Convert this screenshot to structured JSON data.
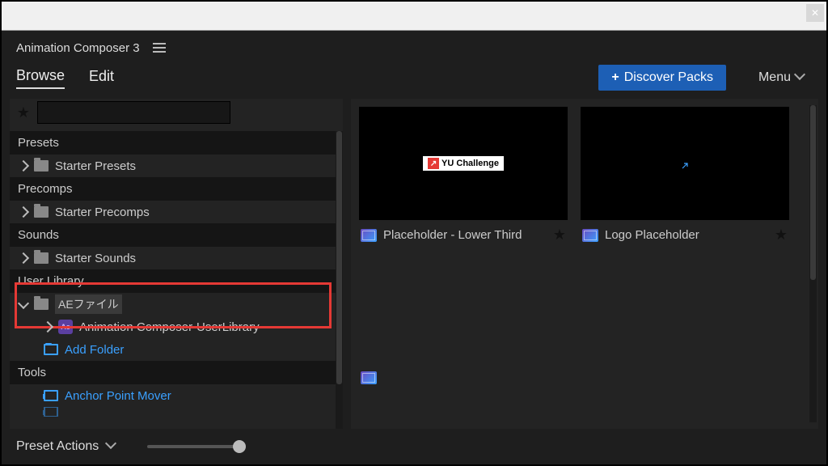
{
  "panel": {
    "title": "Animation Composer 3"
  },
  "tabs": {
    "browse": "Browse",
    "edit": "Edit"
  },
  "buttons": {
    "discover": "Discover Packs",
    "menu": "Menu"
  },
  "search": {
    "placeholder": ""
  },
  "tree": {
    "presets_header": "Presets",
    "starter_presets": "Starter Presets",
    "precomps_header": "Precomps",
    "starter_precomps": "Starter Precomps",
    "sounds_header": "Sounds",
    "starter_sounds": "Starter Sounds",
    "user_library_header": "User Library",
    "ae_folder": "AEファイル",
    "ac_userlib": "Animation Composer-UserLibrary",
    "add_folder": "Add Folder",
    "tools_header": "Tools",
    "anchor_point": "Anchor Point Mover"
  },
  "cards": {
    "c1_label": "Placeholder - Lower Third",
    "c1_badge": "YU Challenge",
    "c2_label": "Logo Placeholder"
  },
  "footer": {
    "preset_actions": "Preset Actions"
  }
}
